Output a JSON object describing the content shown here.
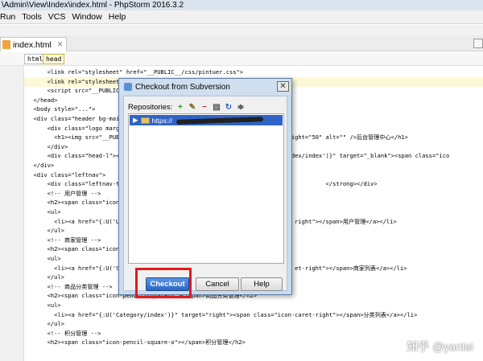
{
  "window": {
    "title": "\\Admin\\View\\Index\\index.html - PhpStorm 2016.3.2"
  },
  "menu": [
    "Run",
    "Tools",
    "VCS",
    "Window",
    "Help"
  ],
  "tabs": [
    {
      "label": "index.html"
    }
  ],
  "breadcrumbs": [
    "html",
    "head"
  ],
  "editor": {
    "line_numbers": [
      "",
      "",
      "",
      "",
      "",
      "",
      "",
      "",
      "",
      "",
      "",
      "",
      "",
      "",
      "",
      "",
      "",
      "",
      "",
      "",
      "",
      "",
      "",
      "",
      "",
      "",
      "",
      "",
      "",
      ""
    ],
    "lines": [
      "      <link rel=\"stylesheet\" href=\"__PUBLIC__/css/pintuer.css\">",
      "      <link rel=\"stylesheet\"",
      "      <script src=\"__PUBLIC_",
      "  </head>",
      "  <body style=\"...\">",
      "  <div class=\"header bg-main",
      "      <div class=\"logo margin-",
      "        <h1><img src=\"__PUBLIC_                                          \" height=\"50\" alt=\"\" />后台管理中心</h1>",
      "      </div>",
      "      <div class=\"head-l\"><a c                                         ome/index/index')}\" target=\"_blank\"><span class=\"ico",
      "  </div>",
      "  <div class=\"leftnav\">",
      "      <div class=\"leftnav-titl                                                         </strong></div>",
      "      <!-- 用户管理 -->",
      "      <h2><span class=\"icon-pe",
      "      <ul>",
      "        <li><a href=\"{:U('User                                                right\"></span>用户管理</a></li>",
      "      </ul>",
      "      <!-- 商家管理 -->",
      "      <h2><span class=\"icon-pe",
      "      <ul>",
      "        <li><a href=\"{:U('Sell                                                et-right\"></span>商家列表</a></li>",
      "      </ul>",
      "      <!-- 商品分类管理 -->",
      "      <h2><span class=\"icon-pencil-square-o\"></span>商品分类管理</h2>",
      "      <ul>",
      "        <li><a href=\"{:U('Category/index')}\" target=\"right\"><span class=\"icon-caret-right\"></span>分类列表</a></li>",
      "      </ul>",
      "      <!-- 积分管理 -->",
      "      <h2><span class=\"icon-pencil-square-o\"></span>积分管理</h2>"
    ]
  },
  "dialog": {
    "title": "Checkout from Subversion",
    "repositories_label": "Repositories:",
    "toolbar_icons": [
      "add-icon",
      "edit-icon",
      "remove-icon",
      "browse-icon",
      "refresh-icon",
      "collapse-icon"
    ],
    "repo_url": "https://",
    "buttons": {
      "checkout": "Checkout",
      "cancel": "Cancel",
      "help": "Help"
    }
  },
  "watermark": "知乎 @yanlei",
  "colors": {
    "highlight_box": "#e01b1b",
    "selection": "#2f64c6"
  }
}
